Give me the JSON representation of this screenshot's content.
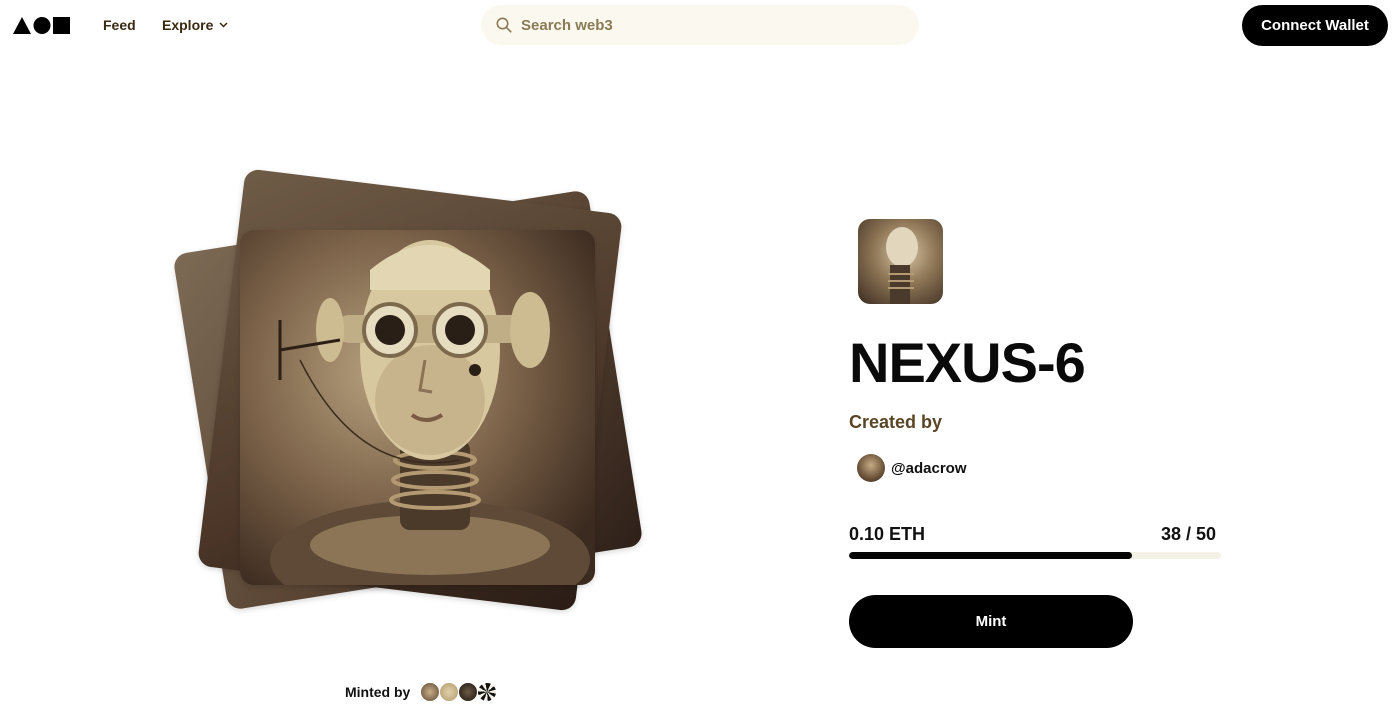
{
  "header": {
    "logo_icon": "shapes-logo-icon",
    "nav": {
      "feed_label": "Feed",
      "explore_label": "Explore"
    },
    "search": {
      "placeholder": "Search web3"
    },
    "connect_wallet_label": "Connect Wallet"
  },
  "artwork": {
    "minted_by_label": "Minted by",
    "minter_avatar_count": 4
  },
  "detail": {
    "title": "NEXUS-6",
    "created_by_label": "Created by",
    "creator_handle": "@adacrow",
    "price": "0.10 ETH",
    "supply": "38 / 50",
    "minted_fraction": 0.76,
    "mint_label": "Mint"
  },
  "colors": {
    "accent": "#000000",
    "sepia_text": "#5a4526",
    "search_bg": "#fbf9ef"
  }
}
